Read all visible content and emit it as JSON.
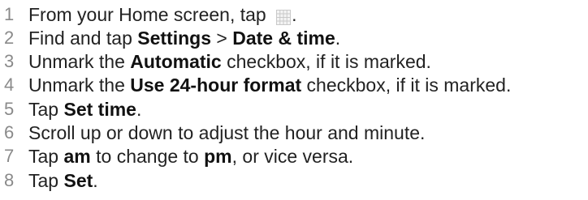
{
  "steps": [
    {
      "number": "1",
      "parts": [
        {
          "t": "text",
          "v": "From your Home screen, tap "
        },
        {
          "t": "icon",
          "v": "app-grid-icon"
        },
        {
          "t": "text",
          "v": "."
        }
      ]
    },
    {
      "number": "2",
      "parts": [
        {
          "t": "text",
          "v": "Find and tap "
        },
        {
          "t": "bold",
          "v": "Settings"
        },
        {
          "t": "text",
          "v": " > "
        },
        {
          "t": "bold",
          "v": "Date & time"
        },
        {
          "t": "text",
          "v": "."
        }
      ]
    },
    {
      "number": "3",
      "parts": [
        {
          "t": "text",
          "v": "Unmark the "
        },
        {
          "t": "bold",
          "v": "Automatic"
        },
        {
          "t": "text",
          "v": " checkbox, if it is marked."
        }
      ]
    },
    {
      "number": "4",
      "parts": [
        {
          "t": "text",
          "v": "Unmark the "
        },
        {
          "t": "bold",
          "v": "Use 24-hour format"
        },
        {
          "t": "text",
          "v": " checkbox, if it is marked."
        }
      ]
    },
    {
      "number": "5",
      "parts": [
        {
          "t": "text",
          "v": "Tap "
        },
        {
          "t": "bold",
          "v": "Set time"
        },
        {
          "t": "text",
          "v": "."
        }
      ]
    },
    {
      "number": "6",
      "parts": [
        {
          "t": "text",
          "v": "Scroll up or down to adjust the hour and minute."
        }
      ]
    },
    {
      "number": "7",
      "parts": [
        {
          "t": "text",
          "v": "Tap "
        },
        {
          "t": "bold",
          "v": "am"
        },
        {
          "t": "text",
          "v": " to change to "
        },
        {
          "t": "bold",
          "v": "pm"
        },
        {
          "t": "text",
          "v": ", or vice versa."
        }
      ]
    },
    {
      "number": "8",
      "parts": [
        {
          "t": "text",
          "v": "Tap "
        },
        {
          "t": "bold",
          "v": "Set"
        },
        {
          "t": "text",
          "v": "."
        }
      ]
    }
  ]
}
